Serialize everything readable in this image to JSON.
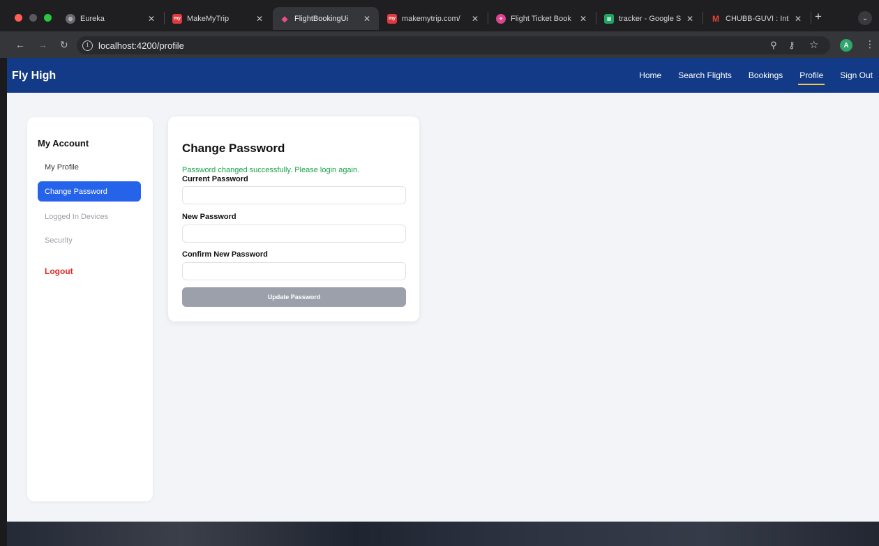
{
  "browser": {
    "tabs": [
      {
        "title": "Eureka",
        "icon": "globe-icon",
        "color": "#6b6b70"
      },
      {
        "title": "MakeMyTrip",
        "icon": "makemytrip-favicon",
        "color": "#e03a3e"
      },
      {
        "title": "FlightBookingUi",
        "icon": "angular-favicon",
        "color": "#c3002f"
      },
      {
        "title": "makemytrip.com/",
        "icon": "makemytrip-favicon",
        "color": "#e03a3e"
      },
      {
        "title": "Flight Ticket Book",
        "icon": "flight-favicon",
        "color": "#d9468f"
      },
      {
        "title": "tracker - Google S",
        "icon": "sheets-favicon",
        "color": "#1fa463"
      },
      {
        "title": "CHUBB-GUVI : Int",
        "icon": "gmail-favicon",
        "color": "#ea4335"
      }
    ],
    "active_tab_index": 2,
    "url": "localhost:4200/profile",
    "avatar_letter": "A",
    "avatar_color": "#2fa66a"
  },
  "navbar": {
    "brand": "Fly High",
    "links": [
      "Home",
      "Search Flights",
      "Bookings",
      "Profile",
      "Sign Out"
    ],
    "active_link": "Profile",
    "background": "#123a86",
    "active_underline_color": "#f6c84b"
  },
  "sidebar": {
    "title": "My Account",
    "items": [
      {
        "label": "My Profile",
        "state": "normal"
      },
      {
        "label": "Change Password",
        "state": "active"
      },
      {
        "label": "Logged In Devices",
        "state": "muted"
      },
      {
        "label": "Security",
        "state": "muted"
      }
    ],
    "logout_label": "Logout",
    "active_color": "#2563eb",
    "logout_color": "#dc2626"
  },
  "form": {
    "title": "Change Password",
    "success_message": "Password changed successfully. Please login again.",
    "success_color": "#16a34a",
    "current_label": "Current Password",
    "current_value": "",
    "new_label": "New Password",
    "new_value": "",
    "confirm_label": "Confirm New Password",
    "confirm_value": "",
    "submit_label": "Update Password",
    "submit_disabled": true
  }
}
